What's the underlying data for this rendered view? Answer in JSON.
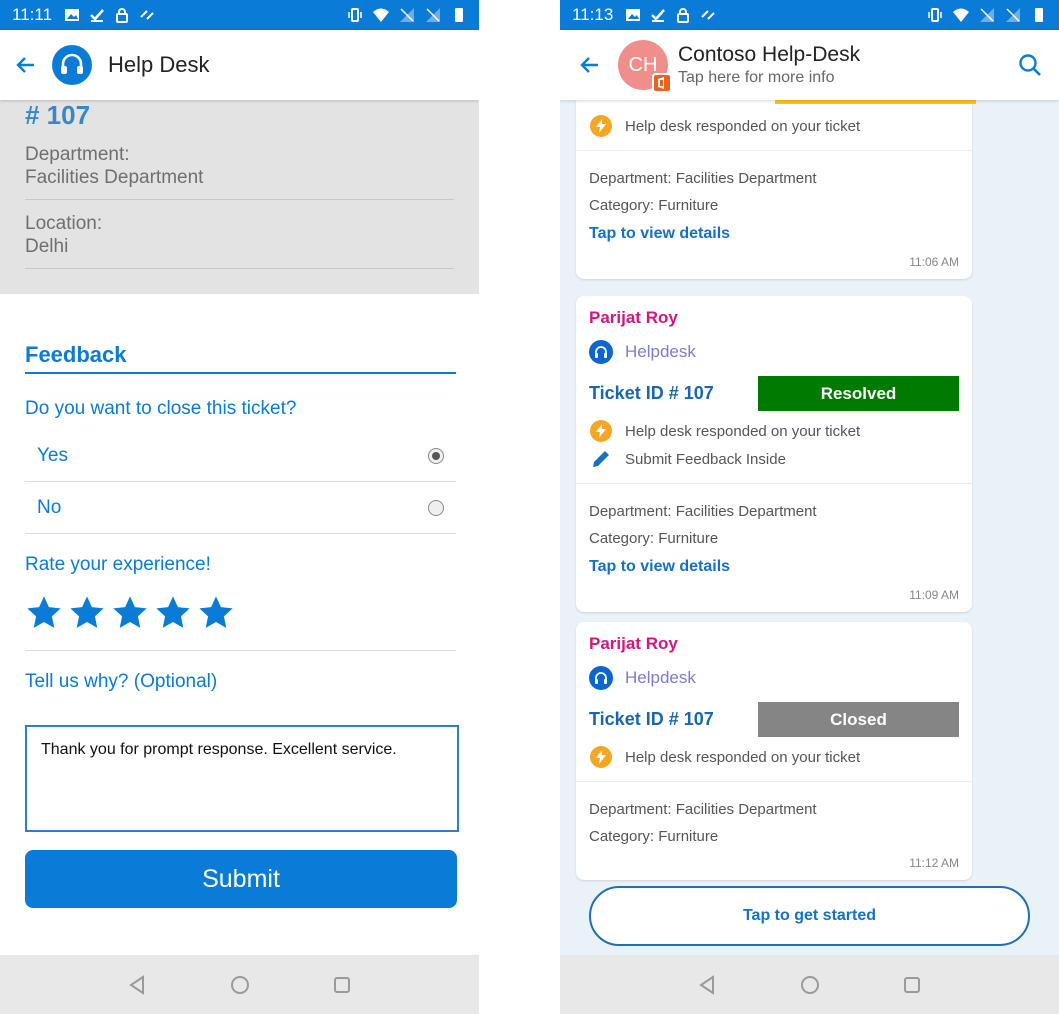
{
  "left": {
    "status": {
      "time": "11:11"
    },
    "appbar": {
      "title": "Help Desk"
    },
    "ticket": {
      "number": "# 107",
      "fields": [
        {
          "label": "Department:",
          "value": "Facilities Department"
        },
        {
          "label": "Location:",
          "value": "Delhi"
        }
      ]
    },
    "feedback": {
      "title": "Feedback",
      "close_question": "Do you want to close this ticket?",
      "options": [
        {
          "label": "Yes",
          "selected": true
        },
        {
          "label": "No",
          "selected": false
        }
      ],
      "rate_label": "Rate your experience!",
      "rating": 5,
      "rating_max": 5,
      "why_label": "Tell us why? (Optional)",
      "comment": "Thank you for prompt response. Excellent service.",
      "submit_label": "Submit"
    }
  },
  "right": {
    "status": {
      "time": "11:13"
    },
    "appbar": {
      "avatar_initials": "CH",
      "title": "Contoso Help-Desk",
      "subtitle": "Tap here for more info"
    },
    "cards": [
      {
        "activity": [
          "Help desk responded on your ticket"
        ],
        "department": "Department: Facilities Department",
        "category": "Category: Furniture",
        "link": "Tap to view details",
        "time": "11:06 AM"
      },
      {
        "sender": "Parijat Roy",
        "app": "Helpdesk",
        "ticket_id": "Ticket ID # 107",
        "status": "Resolved",
        "status_color": "#007b00",
        "activity": [
          "Help desk responded on your ticket",
          "Submit Feedback Inside"
        ],
        "department": "Department: Facilities Department",
        "category": "Category: Furniture",
        "link": "Tap to view details",
        "time": "11:09 AM"
      },
      {
        "sender": "Parijat Roy",
        "app": "Helpdesk",
        "ticket_id": "Ticket ID # 107",
        "status": "Closed",
        "status_color": "#858585",
        "activity": [
          "Help desk responded on your ticket"
        ],
        "department": "Department: Facilities Department",
        "category": "Category: Furniture",
        "time": "11:12 AM"
      }
    ],
    "start_button": "Tap to get started"
  },
  "colors": {
    "accent": "#0a7bd6",
    "sender": "#d4157d",
    "resolved": "#007b00",
    "closed": "#858585",
    "highlight": "#fbc31a"
  }
}
